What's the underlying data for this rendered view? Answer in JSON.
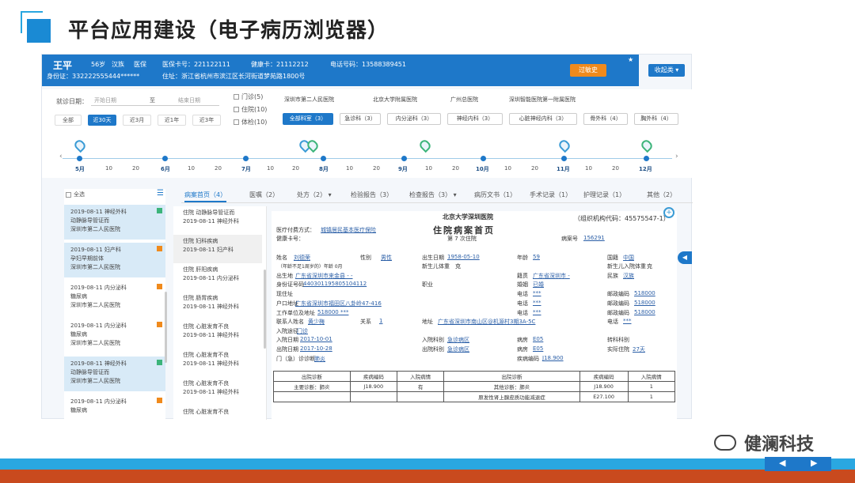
{
  "slide": {
    "title": "平台应用建设（电子病历浏览器）",
    "brand": "健澜科技"
  },
  "patient": {
    "name": "王平",
    "age": "56岁",
    "ethnicity": "汉族",
    "insurance": "医保",
    "medical_card": "医保卡号：221122111",
    "health_card": "健康卡：21112212",
    "phone": "电话号码：13588389451",
    "id_card": "身份证：332222555444******",
    "address": "住址：浙江省杭州市滨江区长河街道梦苑路1800号"
  },
  "header_buttons": {
    "orange": "过敏史",
    "collapse": "收起类 ▾"
  },
  "filters": {
    "visit_date_label": "就诊日期：",
    "start_placeholder": "开始日期",
    "to": "至",
    "end_placeholder": "结束日期",
    "ranges": [
      "全部",
      "近30天",
      "近3月",
      "近1年",
      "近3年"
    ],
    "types": [
      "门诊(5)",
      "住院(10)",
      "体检(10)"
    ],
    "hospitals": [
      "深圳市第二人民医院",
      "北京大学附属医院",
      "广州总医院",
      "深圳智能医院第一附属医院"
    ],
    "departments": [
      "全部科室（3）",
      "急诊科（3）",
      "内分泌科（3）",
      "神经内科（3）",
      "心脏神经内科（3）",
      "骨外科（4）",
      "胸外科（4）"
    ]
  },
  "timeline": {
    "months": [
      "5月",
      "6月",
      "7月",
      "8月",
      "9月",
      "10月",
      "11月",
      "12月"
    ],
    "mid": [
      "10",
      "20"
    ]
  },
  "sidebar": {
    "select_all": "全选",
    "items": [
      {
        "line1": "2019-08-11  神经外科",
        "line2": "动静脉导管证而",
        "line3": "深圳市第二人民医院"
      },
      {
        "line1": "2019-08-11  妇产科",
        "line2": "孕妇早期前体",
        "line3": "深圳市第二人民医院"
      },
      {
        "line1": "2019-08-11  内分泌科",
        "line2": "糖尿病",
        "line3": "深圳市第二人民医院"
      },
      {
        "line1": "2019-08-11  内分泌科",
        "line2": "糖尿病",
        "line3": "深圳市第二人民医院"
      },
      {
        "line1": "2019-08-11  神经外科",
        "line2": "动静脉导管证而",
        "line3": "深圳市第二人民医院"
      },
      {
        "line1": "2019-08-11  内分泌科",
        "line2": "糖尿病",
        "line3": ""
      }
    ]
  },
  "tabs": [
    "病案首页（4）",
    "医嘱（2）",
    "处方（2） ▾",
    "检验报告（3）",
    "检查报告（3） ▾",
    "病历文书（1）",
    "手术记录（1）",
    "护理记录（1）",
    "其他（2）"
  ],
  "mid_list": [
    {
      "line1": "住院  动静脉导管证而",
      "line2": "2019-08-11   神经外科"
    },
    {
      "line1": "住院  妇科疾病",
      "line2": "2019-08-11   妇产科"
    },
    {
      "line1": "住院  肝阳疾病",
      "line2": "2019-08-11   内分泌科"
    },
    {
      "line1": "住院  肠胃疾病",
      "line2": "2019-08-11   神经外科"
    },
    {
      "line1": "住院  心脏发育不良",
      "line2": "2019-08-11   神经外科"
    },
    {
      "line1": "住院  心脏发育不良",
      "line2": "2019-08-11   神经外科"
    },
    {
      "line1": "住院  心脏发育不良",
      "line2": "2019-08-11   神经外科"
    },
    {
      "line1": "住院  心脏发育不良",
      "line2": ""
    }
  ],
  "doc": {
    "hospital": "北京大学深圳医院",
    "org_code": "（组织机构代码：45575547-1）",
    "title": "住院病案首页",
    "pay_label": "医疗付费方式：",
    "pay_value": "城镇居民基本医疗保险",
    "card_label": "健康卡号：",
    "visits": "第 7 次住院",
    "case_no_label": "病案号",
    "case_no": "156291",
    "rows": [
      [
        "姓名",
        "刘德荣",
        "性别",
        "男性",
        "出生日期",
        "1958-05-10",
        "年龄",
        "59",
        "国籍",
        "中国"
      ],
      [
        "（年龄不足1周岁的）年龄 0月",
        "",
        "",
        "",
        "新生儿体重",
        "克",
        "",
        "",
        "新生儿入院体重",
        "克"
      ],
      [
        "出生地",
        "广东省深圳市来金县 - -",
        "",
        "",
        "籍贯",
        "广东省深圳市 -",
        "",
        "",
        "民族",
        "汉族"
      ],
      [
        "身份证号码",
        "440301195805104112",
        "",
        "",
        "职业",
        "",
        "婚姻",
        "已婚",
        "",
        ""
      ],
      [
        "现住址",
        "",
        "",
        "",
        "电话",
        "***",
        "",
        "",
        "邮政编码",
        "518000"
      ],
      [
        "户口地址",
        "广东省深圳市福田区八卦岭47-416",
        "",
        "",
        "电话",
        "***",
        "",
        "",
        "邮政编码",
        "518000"
      ],
      [
        "工作单位及地址",
        "518000 ***",
        "",
        "",
        "电话",
        "***",
        "",
        "",
        "邮政编码",
        "518000"
      ],
      [
        "联系人姓名",
        "黄少梅",
        "关系",
        "1",
        "地址",
        "广东省深圳市南山区@机源村3期3A-5C",
        "",
        "",
        "电话",
        "***"
      ]
    ],
    "admit_route_label": "入院途径",
    "admit_route": "门诊",
    "admit_time_label": "入院日期",
    "admit_time": "2017-10-01",
    "admit_dept_label": "入院科别",
    "admit_dept": "急诊病区",
    "ward1_label": "病房",
    "ward1": "E05",
    "transfer_label": "转科科别",
    "transfer": "",
    "discharge_time_label": "出院日期",
    "discharge_time": "2017-10-28",
    "discharge_dept_label": "出院科别",
    "discharge_dept": "急诊病区",
    "ward2_label": "病房",
    "ward2": "E05",
    "days_label": "实际住院",
    "days": "27天",
    "op_diag_label": "门（急）诊诊断",
    "op_diag": "肺炎",
    "disease_code_label": "疾病编码",
    "disease_code": "J18.900",
    "table_head": [
      "出院诊断",
      "疾病编码",
      "入院病情",
      "出院诊断",
      "疾病编码",
      "入院病情"
    ],
    "table_rows": [
      [
        "主要诊断：肺炎",
        "J18.900",
        "有",
        "其他诊断：肺炎",
        "J18.900",
        "1"
      ],
      [
        "",
        "",
        "",
        "原发性肾上腺皮质功能减退症",
        "E27.100",
        "1"
      ]
    ]
  },
  "footer_nav": {
    "prev": "◀",
    "next": "▶"
  }
}
